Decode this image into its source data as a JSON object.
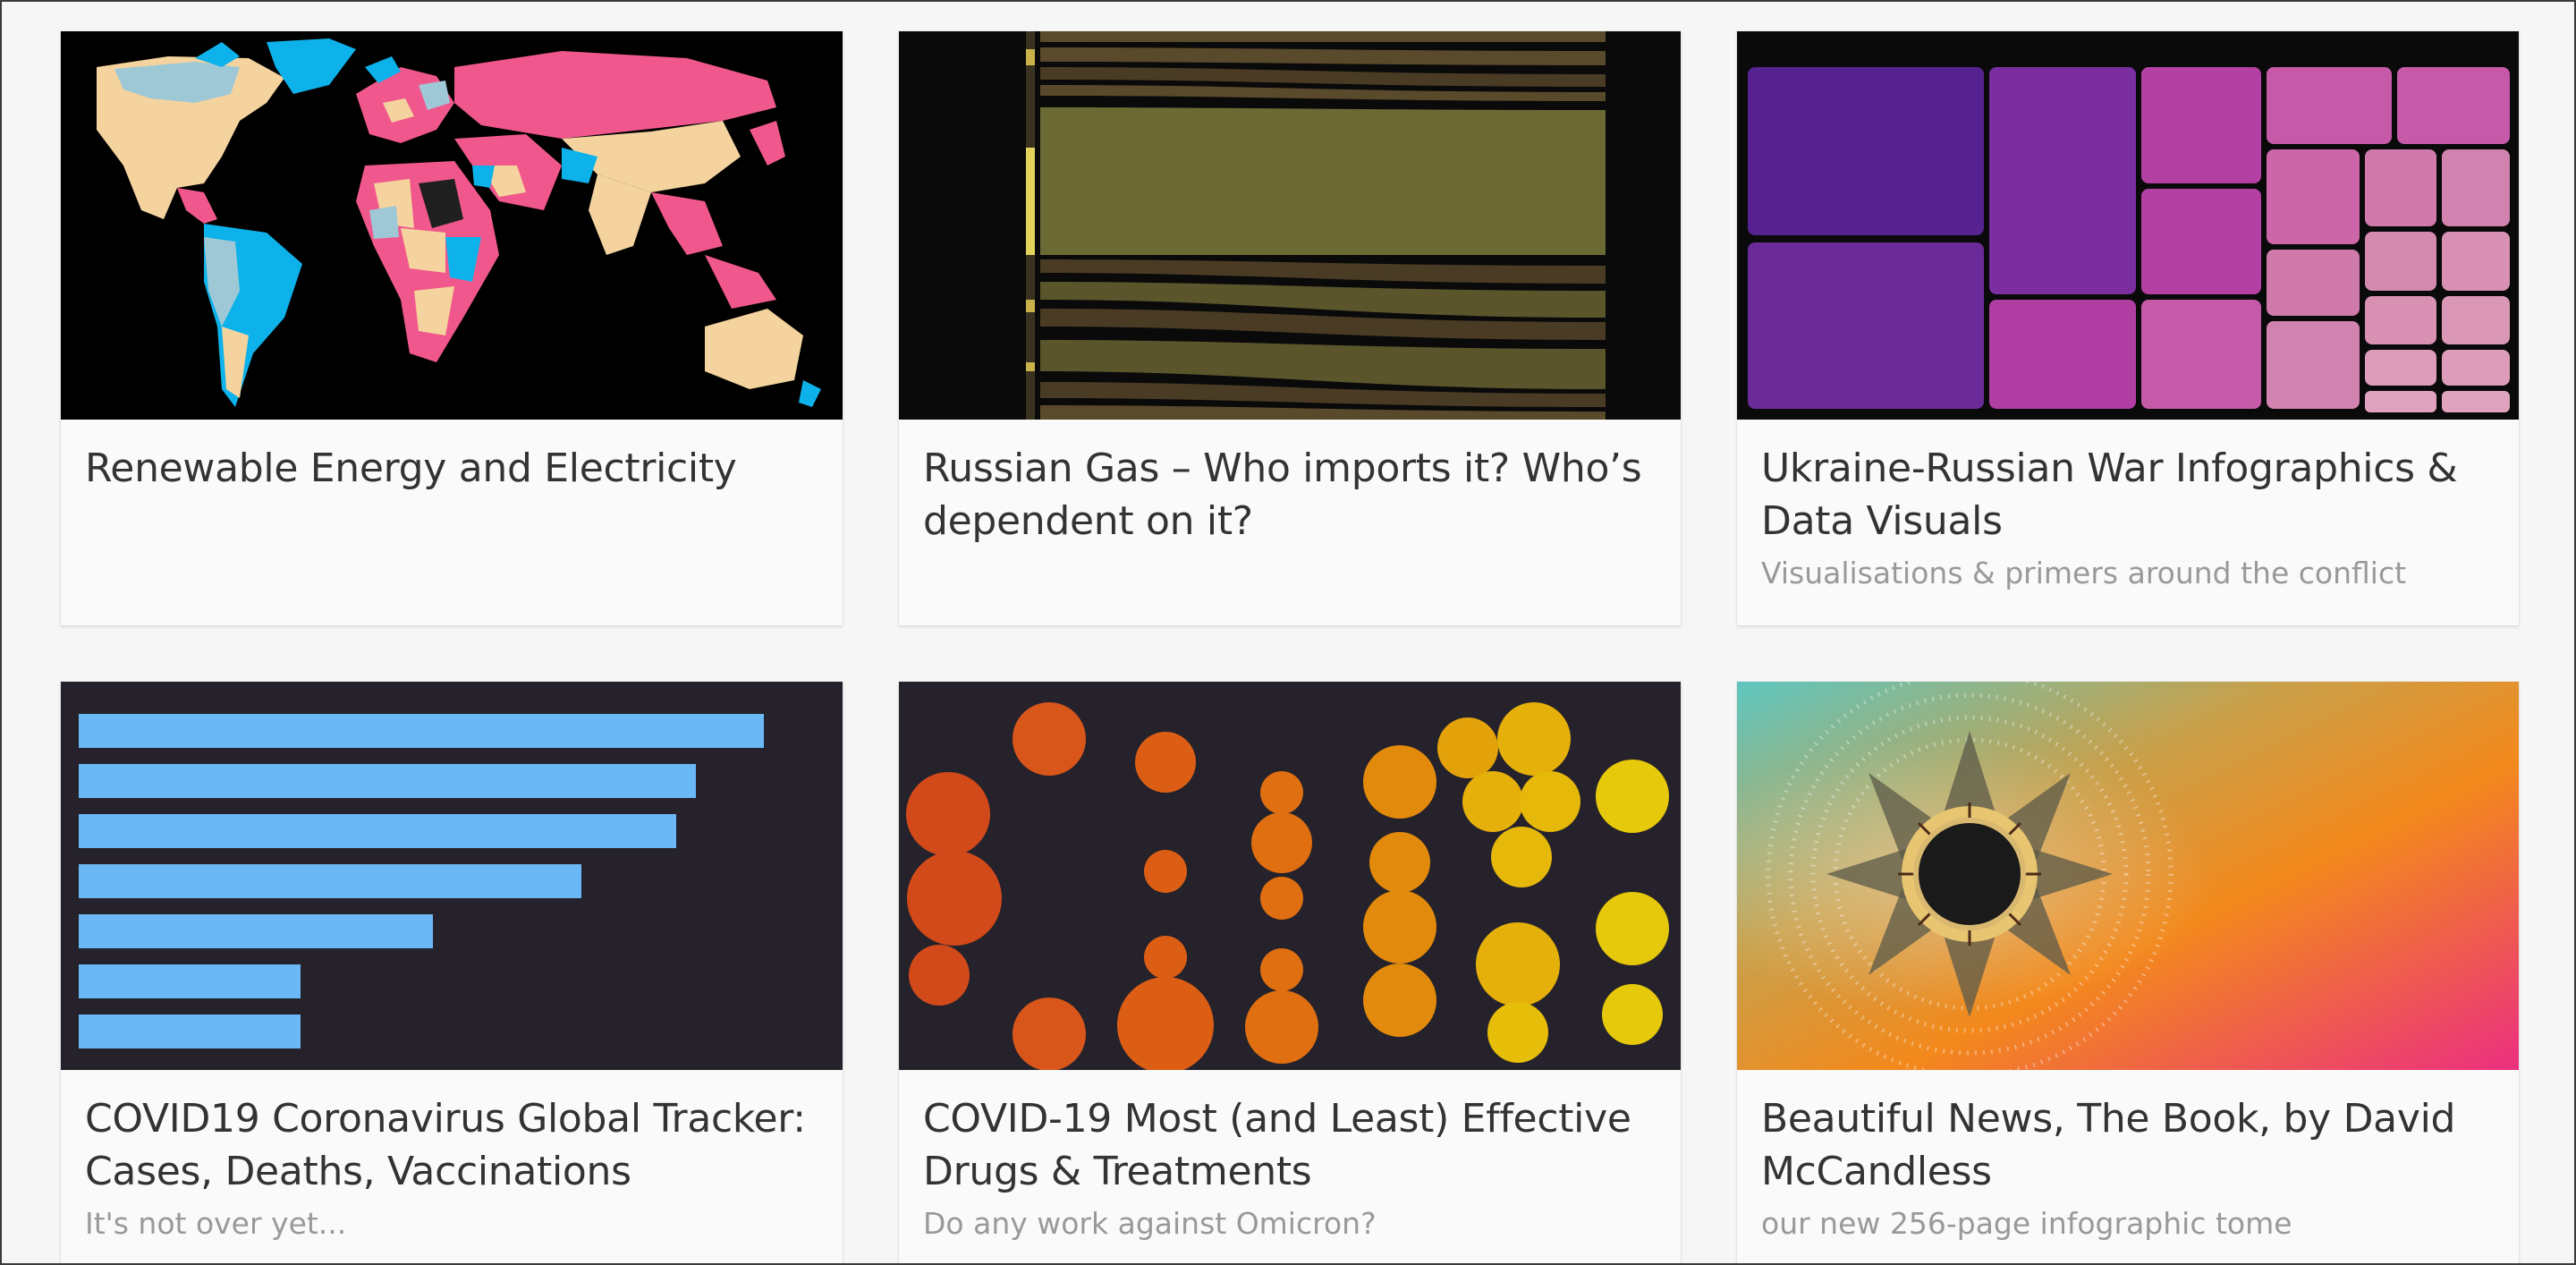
{
  "cards": [
    {
      "title": "Renewable Energy and Electricity",
      "subtitle": "",
      "thumbnail": "world-map"
    },
    {
      "title": "Russian Gas – Who imports it? Who’s dependent on it?",
      "subtitle": "",
      "thumbnail": "sankey-flow"
    },
    {
      "title": "Ukraine-Russian War Infographics & Data Visuals",
      "subtitle": "Visualisations & primers around the conflict",
      "thumbnail": "treemap"
    },
    {
      "title": "COVID19 Coronavirus Global Tracker: Cases, Deaths, Vaccinations",
      "subtitle": "It's not over yet...",
      "thumbnail": "bar-chart"
    },
    {
      "title": "COVID-19 Most (and Least) Effective Drugs & Treatments",
      "subtitle": "Do any work against Omicron?",
      "thumbnail": "bubble-chart"
    },
    {
      "title": "Beautiful News, The Book, by David McCandless",
      "subtitle": "our new 256-page infographic tome",
      "thumbnail": "sunburst-book"
    }
  ],
  "colors": {
    "page_bg": "#f6f6f6",
    "card_bg": "#fafafa",
    "title_text": "#333333",
    "subtitle_text": "#999999",
    "map_pink": "#f0588d",
    "map_blue": "#0eb2ea",
    "map_tan": "#f5d39e",
    "bar_blue": "#6ab8f5",
    "treemap_purple": "#55228f",
    "treemap_pink": "#d98fb3"
  }
}
